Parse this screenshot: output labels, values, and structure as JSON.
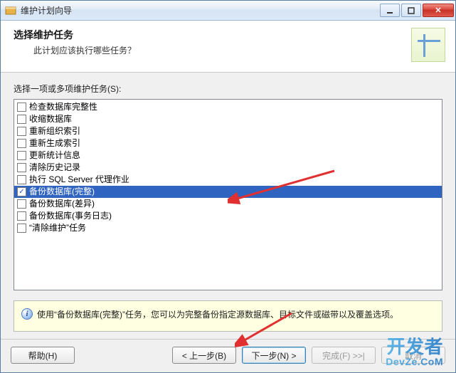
{
  "title": "维护计划向导",
  "header": {
    "title": "选择维护任务",
    "subtitle": "此计划应该执行哪些任务？"
  },
  "prompt": "选择一项或多项维护任务(S):",
  "tasks": [
    {
      "label": "检查数据库完整性",
      "checked": false,
      "selected": false
    },
    {
      "label": "收缩数据库",
      "checked": false,
      "selected": false
    },
    {
      "label": "重新组织索引",
      "checked": false,
      "selected": false
    },
    {
      "label": "重新生成索引",
      "checked": false,
      "selected": false
    },
    {
      "label": "更新统计信息",
      "checked": false,
      "selected": false
    },
    {
      "label": "清除历史记录",
      "checked": false,
      "selected": false
    },
    {
      "label": "执行 SQL Server 代理作业",
      "checked": false,
      "selected": false
    },
    {
      "label": "备份数据库(完整)",
      "checked": true,
      "selected": true
    },
    {
      "label": "备份数据库(差异)",
      "checked": false,
      "selected": false
    },
    {
      "label": "备份数据库(事务日志)",
      "checked": false,
      "selected": false
    },
    {
      "label": "“清除维护”任务",
      "checked": false,
      "selected": false
    }
  ],
  "description": "使用“备份数据库(完整)”任务，您可以为完整备份指定源数据库、目标文件或磁带以及覆盖选项。",
  "buttons": {
    "help": "帮助(H)",
    "back": "< 上一步(B)",
    "next": "下一步(N) >",
    "finish": "完成(F) >>|",
    "cancel": "取消"
  },
  "watermark": {
    "line1": "开发者",
    "line2": "DevZe.CoM"
  }
}
